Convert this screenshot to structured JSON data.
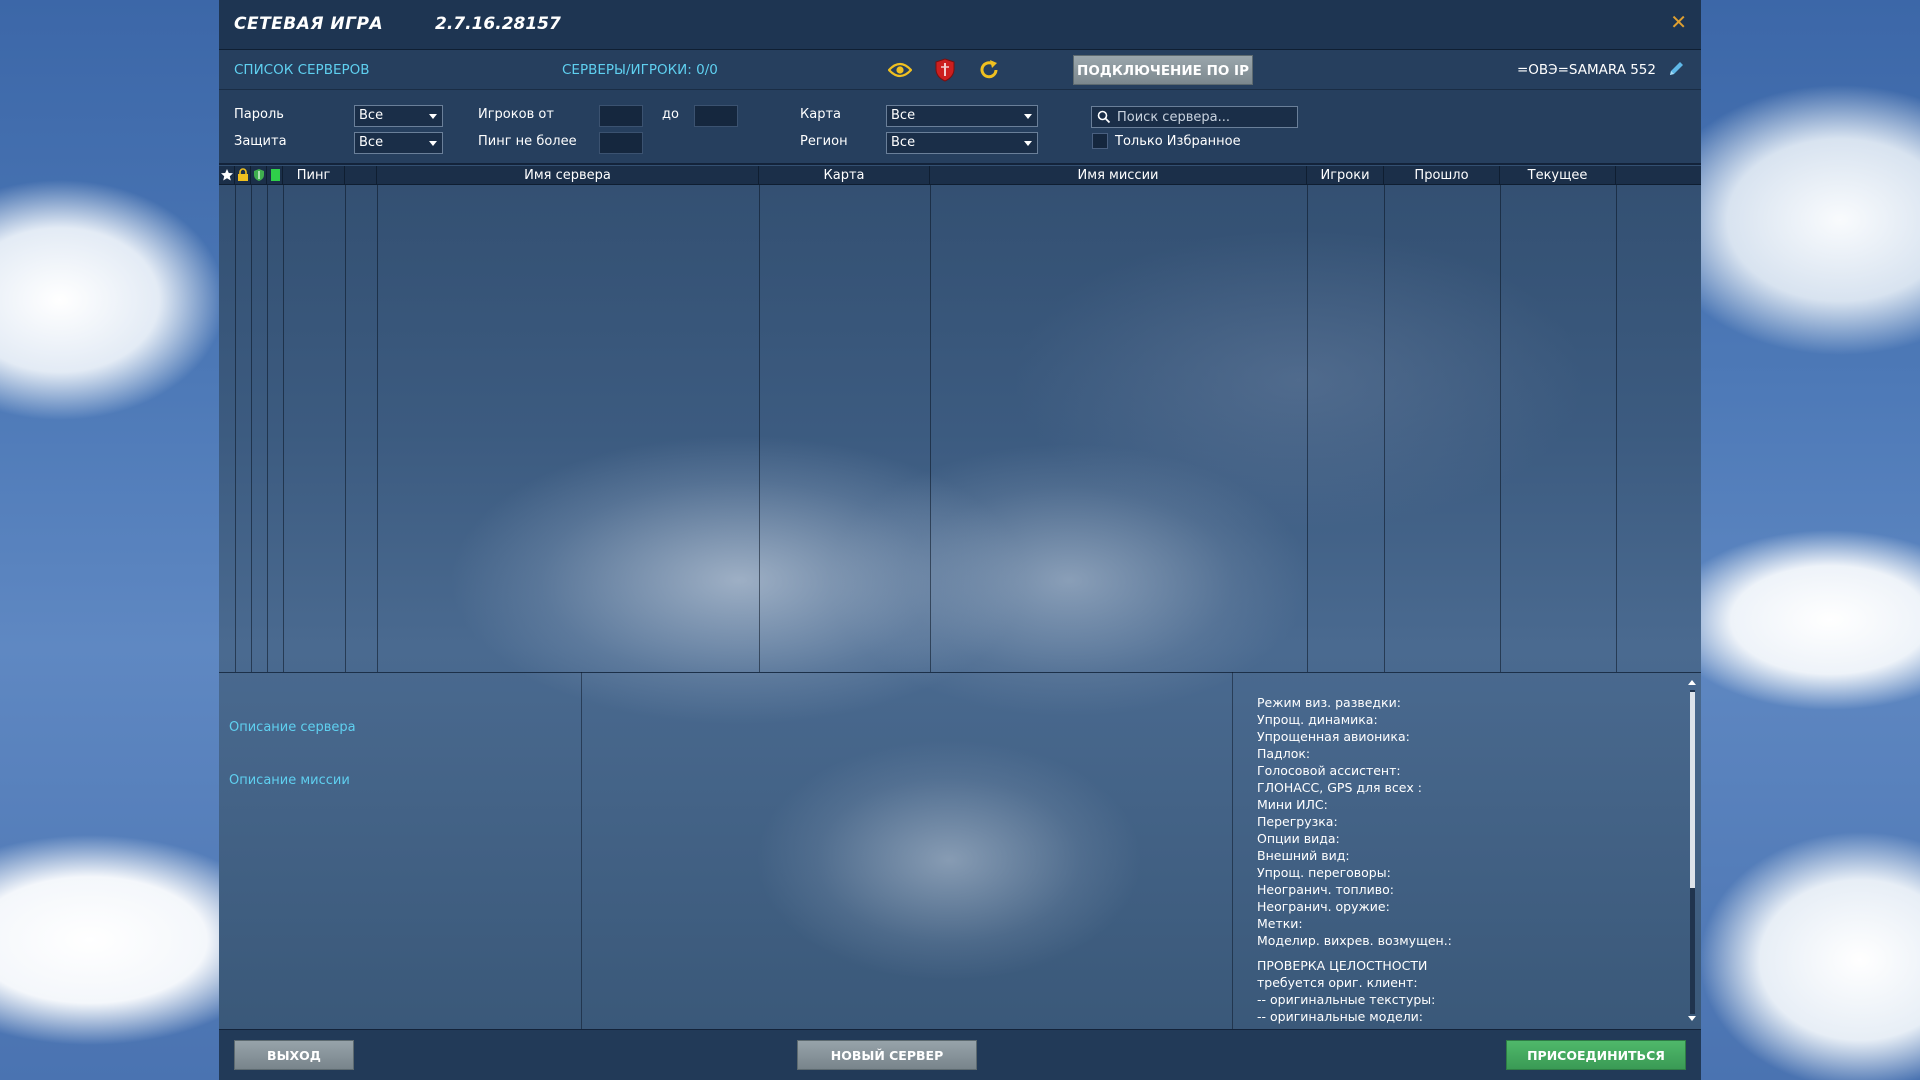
{
  "window": {
    "title": "СЕТЕВАЯ ИГРА",
    "version": "2.7.16.28157"
  },
  "toolbar": {
    "server_list": "СПИСОК СЕРВЕРОВ",
    "servers_players": "СЕРВЕРЫ/ИГРОКИ: 0/0",
    "connect_ip": "ПОДКЛЮЧЕНИЕ ПО IP",
    "username": "=ОВЭ=SAMARA 552",
    "icons": [
      "eye-icon",
      "shield-icon",
      "refresh-icon",
      "pencil-icon"
    ]
  },
  "filters": {
    "password_label": "Пароль",
    "password_value": "Все",
    "protection_label": "Защита",
    "protection_value": "Все",
    "players_from_label": "Игроков от",
    "players_to_label": "до",
    "ping_label": "Пинг не более",
    "map_label": "Карта",
    "map_value": "Все",
    "region_label": "Регион",
    "region_value": "Все",
    "search_placeholder": "Поиск сервера...",
    "favorites_only": "Только Избранное"
  },
  "table": {
    "columns": [
      "Пинг",
      "Имя сервера",
      "Карта",
      "Имя миссии",
      "Игроки",
      "Прошло",
      "Текущее"
    ],
    "rows": []
  },
  "details": {
    "server_description": "Описание сервера",
    "mission_description": "Описание миссии",
    "options": [
      "Режим виз. разведки:",
      "Упрощ. динамика:",
      "Упрощенная авионика:",
      "Падлок:",
      "Голосовой ассистент:",
      "ГЛОНАСС, GPS для всех :",
      "Мини ИЛС:",
      "Перегрузка:",
      "Опции вида:",
      "Внешний вид:",
      "Упрощ. переговоры:",
      "Неогранич. топливо:",
      "Неогранич. оружие:",
      "Метки:",
      "Моделир. вихрев. возмущен.:"
    ],
    "integrity": [
      "ПРОВЕРКА ЦЕЛОСТНОСТИ",
      "требуется ориг. клиент:",
      "-- оригинальные текстуры:",
      "-- оригинальные модели:"
    ]
  },
  "footer": {
    "exit": "ВЫХОД",
    "new_server": "НОВЫЙ СЕРВЕР",
    "join": "ПРИСОЕДИНИТЬСЯ"
  },
  "colors": {
    "accent_link": "#5fd0f0",
    "close": "#e0a030",
    "eye": "#f0c020",
    "shield": "#cc1f1f",
    "join": "#3a9a55"
  }
}
